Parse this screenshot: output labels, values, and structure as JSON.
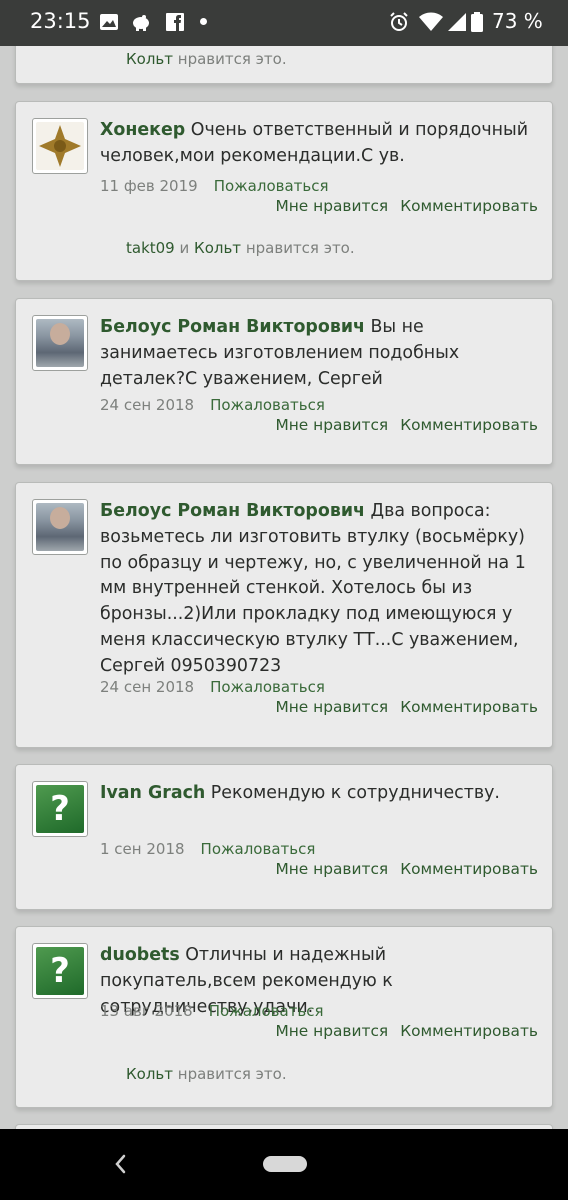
{
  "status_bar": {
    "time": "23:15",
    "battery_percent": "73 %",
    "icons": [
      "image-icon",
      "piggy-bank-icon",
      "facebook-icon",
      "dot",
      "alarm-icon",
      "wifi-icon",
      "signal-icon",
      "battery-icon"
    ]
  },
  "likes_label_suffix": "нравится это.",
  "and_word": "и",
  "report_label": "Пожаловаться",
  "like_label": "Мне нравится",
  "comment_label": "Комментировать",
  "top_partial": {
    "liker": "Кольт"
  },
  "comments": [
    {
      "author": "Хонекер",
      "text": "Очень ответственный и порядочный человек,мои рекомендации.С ув.",
      "date": "11 фев 2019",
      "likers": [
        "takt09",
        "Кольт"
      ],
      "avatar": "cross-icon"
    },
    {
      "author": "Белоус Роман Викторович",
      "text": "Вы не занимаетесь изготовлением подобных деталек?С уважением, Сергей",
      "date": "24 сен 2018",
      "likers": [],
      "avatar": "user-photo"
    },
    {
      "author": "Белоус Роман Викторович",
      "text": "Два вопроса: возьметесь ли изготовить втулку (восьмёрку) по образцу и чертежу, но, с увеличенной на 1 мм внутренней стенкой. Хотелось бы из бронзы...2)Или прокладку под имеющуюся у меня классическую втулку ТТ...С уважением, Сергей 0950390723",
      "date": "24 сен 2018",
      "likers": [],
      "avatar": "user-photo"
    },
    {
      "author": "Ivan Grach",
      "text": "Рекомендую к сотрудничеству.",
      "date": "1 сен 2018",
      "likers": [],
      "avatar": "question-mark"
    },
    {
      "author": "duobets",
      "text": "Отличны и надежный покупатель,всем рекомендую к сотрудничеству,удачи.",
      "date": "13 авг 2018",
      "likers": [
        "Кольт"
      ],
      "avatar": "question-mark"
    }
  ],
  "question_glyph": "?"
}
